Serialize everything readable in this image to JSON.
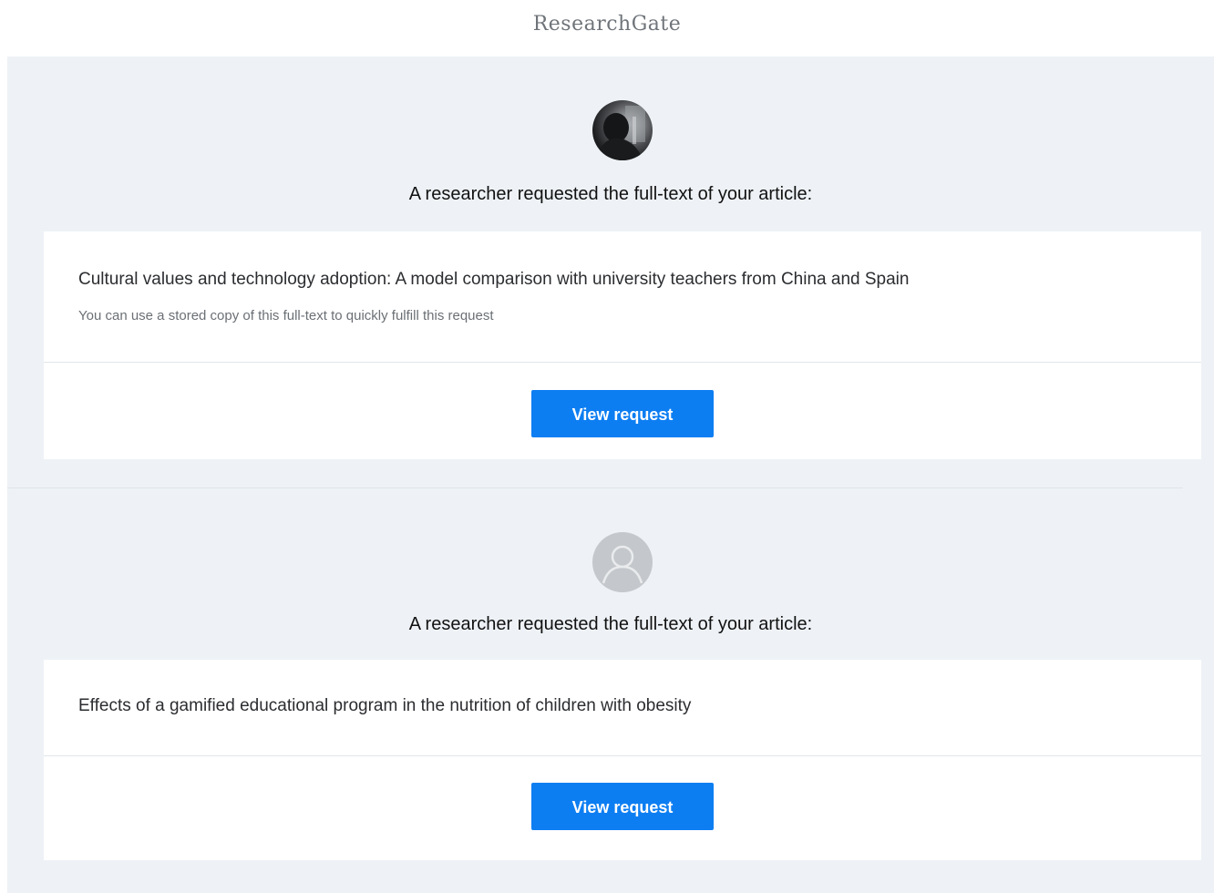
{
  "header": {
    "brand": "ResearchGate"
  },
  "requests": [
    {
      "headline": "A researcher requested the full-text of your article:",
      "article_title": "Cultural values and technology adoption: A model comparison with university teachers from China and Spain",
      "note": "You can use a stored copy of this full-text to quickly fulfill this request",
      "button_label": "View request",
      "avatar": "user-photo-avatar"
    },
    {
      "headline": "A researcher requested the full-text of your article:",
      "article_title": "Effects of a gamified educational program in the nutrition of children with obesity",
      "button_label": "View request",
      "avatar": "default-user-icon"
    }
  ],
  "colors": {
    "button": "#0d7ef2",
    "background": "#eef2f6",
    "card": "#ffffff"
  }
}
